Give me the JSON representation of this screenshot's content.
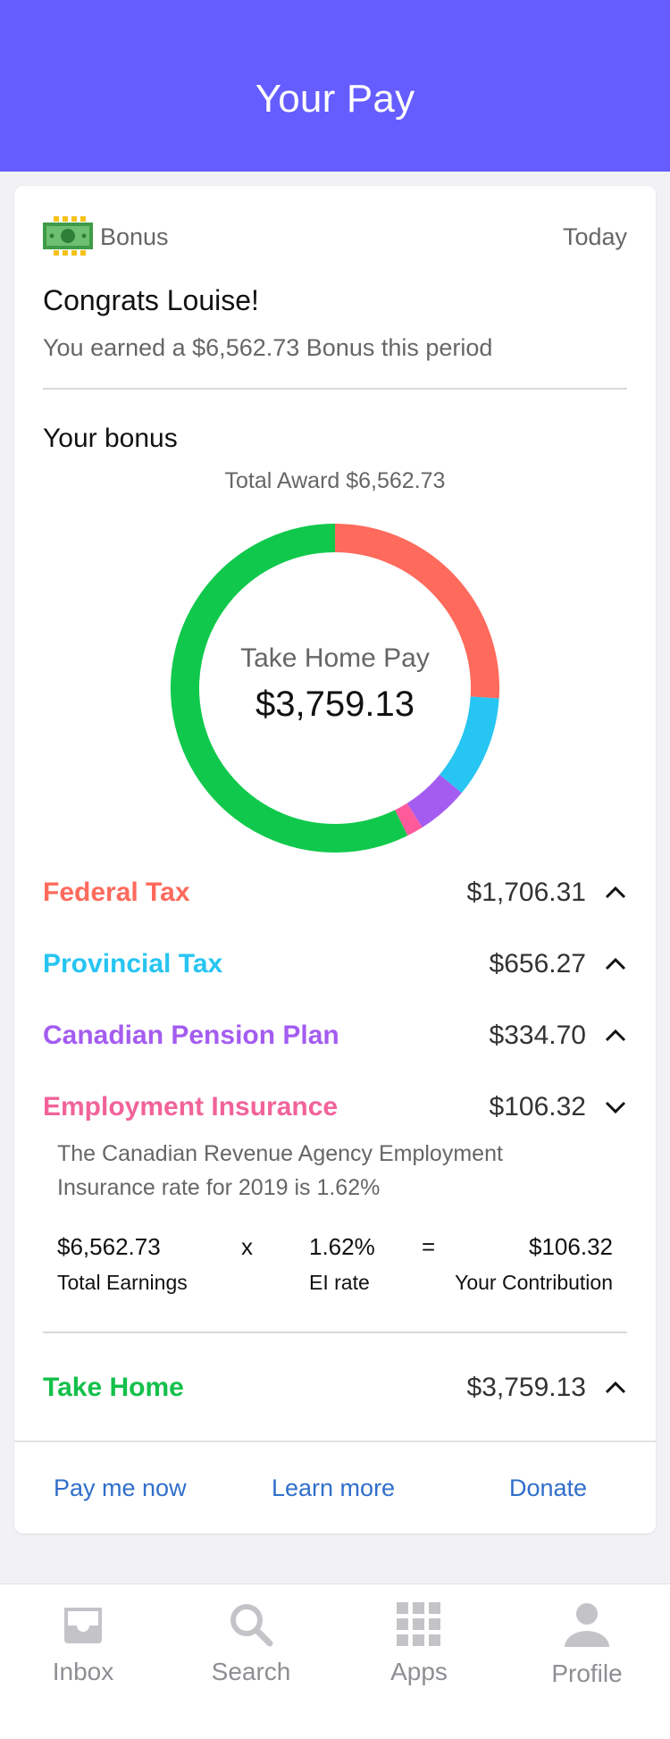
{
  "header": {
    "title": "Your Pay"
  },
  "card": {
    "tag": "Bonus",
    "time": "Today",
    "greeting": "Congrats Louise!",
    "subtitle": "You earned a $6,562.73 Bonus this period"
  },
  "bonus": {
    "heading": "Your bonus",
    "total_award": "Total Award $6,562.73",
    "center_label": "Take Home Pay",
    "center_value": "$3,759.13"
  },
  "chart_data": {
    "type": "pie",
    "title": "",
    "total": 6562.73,
    "start_angle_deg": 0,
    "segments": [
      {
        "name": "Federal Tax",
        "value": 1706.31,
        "color": "#fe6a5c"
      },
      {
        "name": "Provincial Tax",
        "value": 656.27,
        "color": "#26c5f2"
      },
      {
        "name": "Canadian Pension Plan",
        "value": 334.7,
        "color": "#a45cf0"
      },
      {
        "name": "Employment Insurance",
        "value": 106.32,
        "color": "#ff5b9b"
      },
      {
        "name": "Take Home",
        "value": 3759.13,
        "color": "#10c94c"
      }
    ]
  },
  "deductions": [
    {
      "label": "Federal Tax",
      "amount": "$1,706.31",
      "color": "#fe6a5c",
      "expanded": false
    },
    {
      "label": "Provincial Tax",
      "amount": "$656.27",
      "color": "#26c5f2",
      "expanded": false
    },
    {
      "label": "Canadian Pension Plan",
      "amount": "$334.70",
      "color": "#a45cf0",
      "expanded": false
    },
    {
      "label": "Employment Insurance",
      "amount": "$106.32",
      "color": "#f2639a",
      "expanded": true
    }
  ],
  "ei_detail": {
    "description_line1": "The Canadian Revenue Agency Employment",
    "description_line2": "Insurance rate for 2019 is 1.62%",
    "earnings_value": "$6,562.73",
    "earnings_caption": "Total Earnings",
    "times": "x",
    "rate_value": "1.62%",
    "rate_caption": "EI rate",
    "equals": "=",
    "contribution_value": "$106.32",
    "contribution_caption": "Your Contribution"
  },
  "take_home": {
    "label": "Take Home",
    "amount": "$3,759.13",
    "color": "#13c04a"
  },
  "actions": {
    "pay_now": "Pay me now",
    "learn_more": "Learn more",
    "donate": "Donate"
  },
  "tabbar": {
    "items": [
      {
        "label": "Inbox",
        "icon": "inbox-icon"
      },
      {
        "label": "Search",
        "icon": "search-icon"
      },
      {
        "label": "Apps",
        "icon": "apps-grid-icon"
      },
      {
        "label": "Profile",
        "icon": "profile-icon"
      }
    ]
  }
}
